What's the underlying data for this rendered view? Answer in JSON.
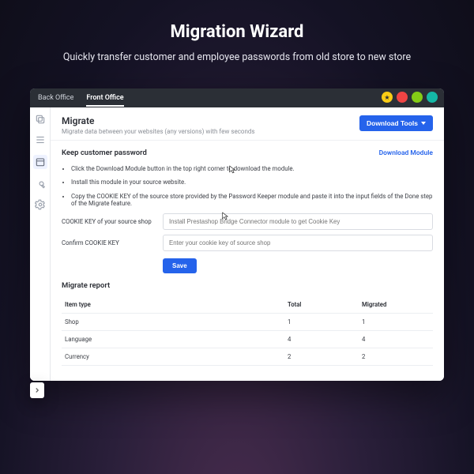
{
  "hero": {
    "title": "Migration Wizard",
    "subtitle": "Quickly transfer customer and employee passwords from old store to new store"
  },
  "topbar": {
    "back_office": "Back Office",
    "front_office": "Front Office"
  },
  "header": {
    "title": "Migrate",
    "subtitle": "Migrate data between your websites (any versions) with few seconds",
    "download_tools": "Download Tools"
  },
  "keep_pw": {
    "heading": "Keep customer password",
    "download_module": "Download Module",
    "bullets": [
      "Click the Download Module button in the top right corner to download the module.",
      "Install this module in your source website.",
      "Copy the COOKIE KEY of the source store provided by the Password Keeper module and paste it into the input fields of the Done step of the Migrate feature."
    ],
    "cookie_label": "COOKIE KEY of your source shop",
    "cookie_ph": "Install Prestashop Bridge Connector module to get Cookie Key",
    "confirm_label": "Confirm COOKIE KEY",
    "confirm_ph": "Enter your cookie key of source shop",
    "save": "Save"
  },
  "report": {
    "title": "Migrate report",
    "cols": {
      "item": "Item type",
      "total": "Total",
      "migrated": "Migrated"
    },
    "rows": [
      {
        "item": "Shop",
        "total": "1",
        "migrated": "1"
      },
      {
        "item": "Language",
        "total": "4",
        "migrated": "4"
      },
      {
        "item": "Currency",
        "total": "2",
        "migrated": "2"
      }
    ]
  }
}
